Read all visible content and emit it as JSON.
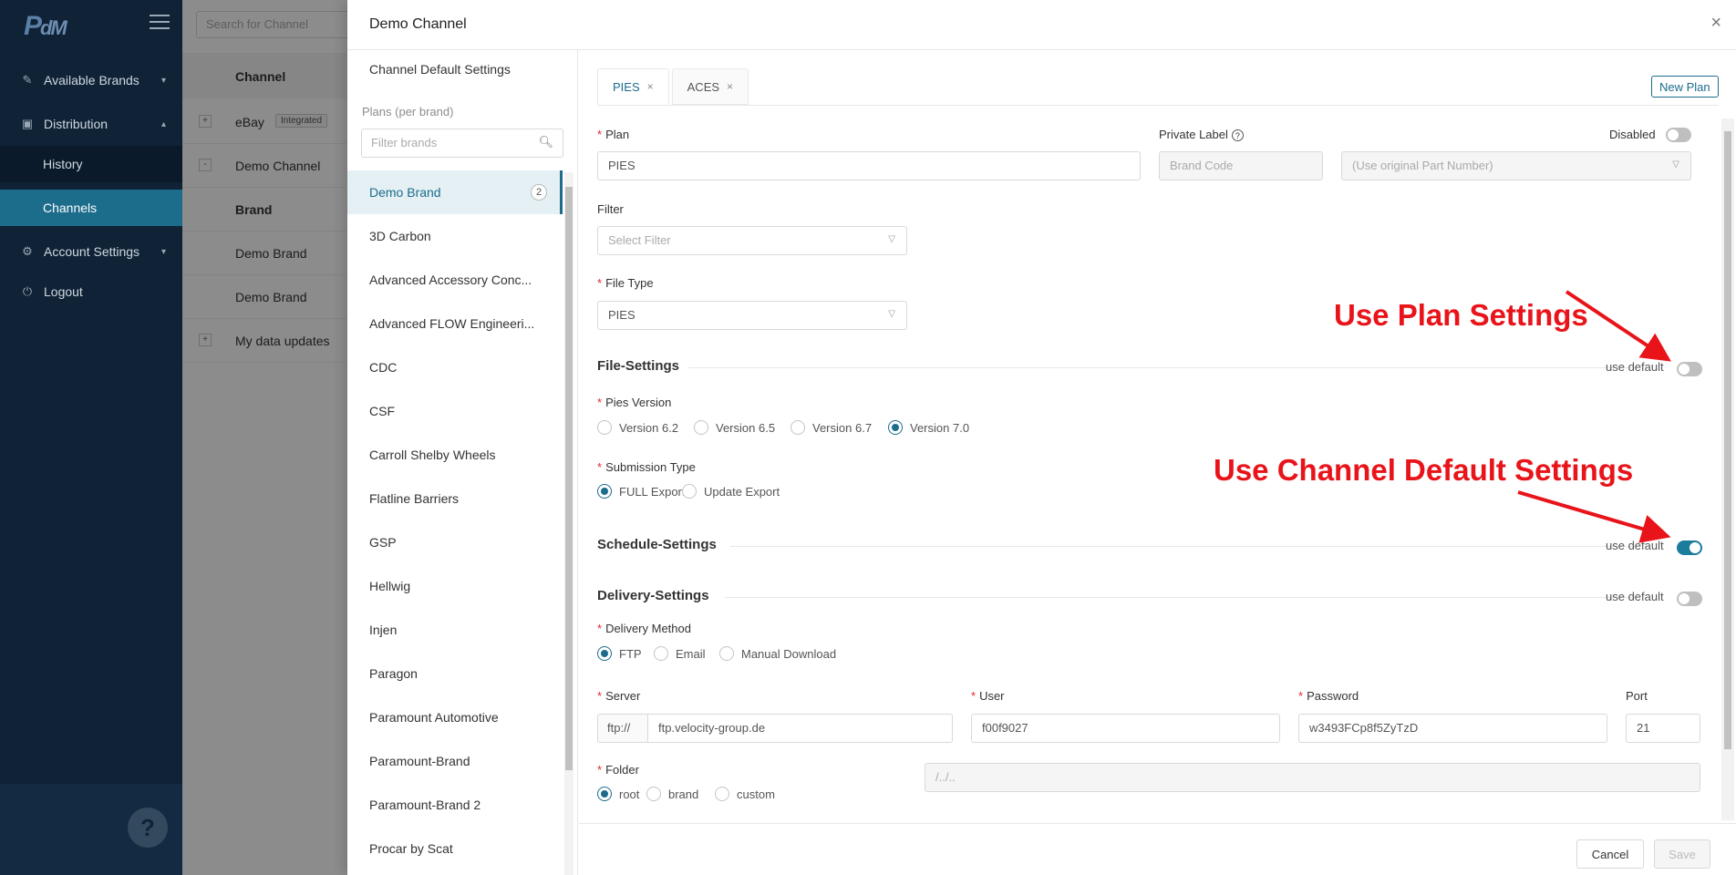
{
  "app": {
    "logo_main": "P",
    "logo_sub": "dM"
  },
  "nav": {
    "items": [
      {
        "label": "Available Brands",
        "icon": "edit-icon"
      },
      {
        "label": "Distribution",
        "icon": "distribution-icon"
      },
      {
        "label": "History"
      },
      {
        "label": "Channels"
      },
      {
        "label": "Account Settings",
        "icon": "gear-icon"
      },
      {
        "label": "Logout",
        "icon": "logout-icon"
      }
    ],
    "help": "?"
  },
  "background": {
    "search_placeholder": "Search for Channel",
    "column_header": "Channel",
    "rows": [
      {
        "label": "eBay",
        "badge": "Integrated",
        "toggle": "+"
      },
      {
        "label": "Demo Channel",
        "toggle": "-"
      },
      {
        "label": "Brand"
      },
      {
        "label": "Demo Brand"
      },
      {
        "label": "Demo Brand"
      },
      {
        "label": "My data updates",
        "toggle": "+"
      }
    ]
  },
  "drawer": {
    "title": "Demo Channel",
    "close": "×",
    "channel_default_settings": "Channel Default Settings",
    "plans_label": "Plans (per brand)",
    "filter_placeholder": "Filter brands",
    "brands": [
      {
        "label": "Demo Brand",
        "count": "2"
      },
      {
        "label": "3D Carbon"
      },
      {
        "label": "Advanced Accessory Conc..."
      },
      {
        "label": "Advanced FLOW Engineeri..."
      },
      {
        "label": "CDC"
      },
      {
        "label": "CSF"
      },
      {
        "label": "Carroll Shelby Wheels"
      },
      {
        "label": "Flatline Barriers"
      },
      {
        "label": "GSP"
      },
      {
        "label": "Hellwig"
      },
      {
        "label": "Injen"
      },
      {
        "label": "Paragon"
      },
      {
        "label": "Paramount Automotive"
      },
      {
        "label": "Paramount-Brand"
      },
      {
        "label": "Paramount-Brand 2"
      },
      {
        "label": "Procar by Scat"
      }
    ],
    "tabs": [
      {
        "label": "PIES",
        "close": "×"
      },
      {
        "label": "ACES",
        "close": "×"
      }
    ],
    "new_plan": "New Plan",
    "form": {
      "plan_label": "Plan",
      "plan_value": "PIES",
      "private_label": "Private Label",
      "brand_code_placeholder": "Brand Code",
      "part_number_placeholder": "(Use original Part Number)",
      "disabled_label": "Disabled",
      "filter_label": "Filter",
      "filter_placeholder": "Select Filter",
      "file_type_label": "File Type",
      "file_type_value": "PIES",
      "file_settings_title": "File-Settings",
      "use_default": "use default",
      "pies_version_label": "Pies Version",
      "pies_versions": [
        "Version 6.2",
        "Version 6.5",
        "Version 6.7",
        "Version 7.0"
      ],
      "pies_version_selected": "Version 7.0",
      "submission_type_label": "Submission Type",
      "submission_types": [
        "FULL Export",
        "Update Export"
      ],
      "submission_selected": "FULL Export",
      "schedule_settings_title": "Schedule-Settings",
      "delivery_settings_title": "Delivery-Settings",
      "delivery_method_label": "Delivery Method",
      "delivery_methods": [
        "FTP",
        "Email",
        "Manual Download"
      ],
      "delivery_selected": "FTP",
      "server_label": "Server",
      "server_prefix": "ftp://",
      "server_value": "ftp.velocity-group.de",
      "user_label": "User",
      "user_value": "f00f9027",
      "password_label": "Password",
      "password_value": "w3493FCp8f5ZyTzD",
      "port_label": "Port",
      "port_value": "21",
      "folder_label": "Folder",
      "folder_options": [
        "root",
        "brand",
        "custom"
      ],
      "folder_selected": "root",
      "folder_path_placeholder": "/../.."
    },
    "toggles": {
      "disabled": false,
      "file_settings_use_default": false,
      "schedule_settings_use_default": true,
      "delivery_settings_use_default": false
    },
    "annotations": {
      "plan": "Use Plan Settings",
      "channel": "Use Channel Default Settings",
      "color": "#e8141a"
    },
    "footer": {
      "cancel": "Cancel",
      "save": "Save"
    }
  },
  "colors": {
    "accent": "#1c6c8c",
    "nav_bg": "#0f2236",
    "required": "#e0282e"
  }
}
